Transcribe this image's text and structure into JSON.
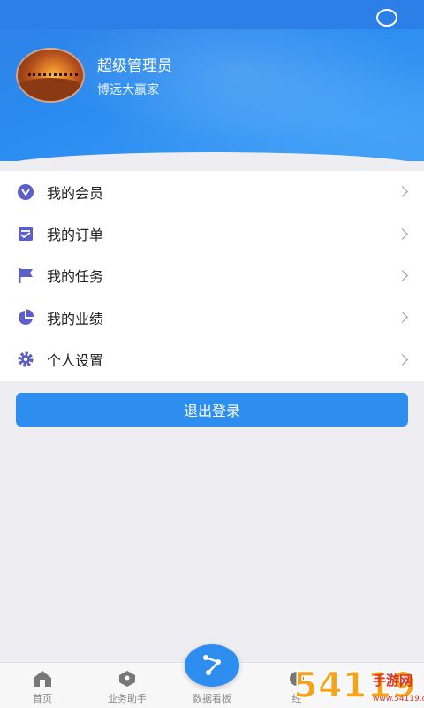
{
  "profile": {
    "name": "超级管理员",
    "subtitle": "博远大赢家"
  },
  "menu": [
    {
      "label": "我的会员",
      "icon": "member-icon"
    },
    {
      "label": "我的订单",
      "icon": "order-icon"
    },
    {
      "label": "我的任务",
      "icon": "flag-icon"
    },
    {
      "label": "我的业绩",
      "icon": "pie-chart-icon"
    },
    {
      "label": "个人设置",
      "icon": "gear-icon"
    }
  ],
  "logout_label": "退出登录",
  "tabs": [
    {
      "label": "首页",
      "icon": "home-icon"
    },
    {
      "label": "业务助手",
      "icon": "tag-icon"
    },
    {
      "label": "数据看板",
      "icon": "dashboard-icon"
    },
    {
      "label": "经",
      "icon": "manage-icon"
    }
  ],
  "watermark": {
    "text": "54119手游网",
    "sub": "www.54119.com"
  },
  "colors": {
    "primary": "#2e8ef0",
    "icon": "#5b5fc7"
  }
}
